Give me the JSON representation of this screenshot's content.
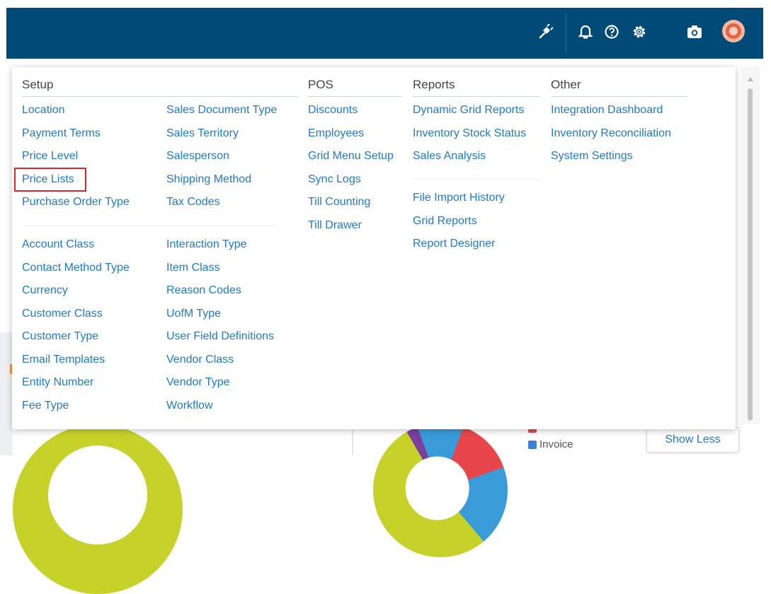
{
  "menu": {
    "setup": {
      "header": "Setup",
      "col1a": [
        "Location",
        "Payment Terms",
        "Price Level",
        "Price Lists",
        "Purchase Order Type"
      ],
      "col2a": [
        "Sales Document Type",
        "Sales Territory",
        "Salesperson",
        "Shipping Method",
        "Tax Codes"
      ],
      "col1b": [
        "Account Class",
        "Contact Method Type",
        "Currency",
        "Customer Class",
        "Customer Type",
        "Email Templates",
        "Entity Number",
        "Fee Type"
      ],
      "col2b": [
        "Interaction Type",
        "Item Class",
        "Reason Codes",
        "UofM Type",
        "User Field Definitions",
        "Vendor Class",
        "Vendor Type",
        "Workflow"
      ]
    },
    "pos": {
      "header": "POS",
      "items": [
        "Discounts",
        "Employees",
        "Grid Menu Setup",
        "Sync Logs",
        "Till Counting",
        "Till Drawer"
      ]
    },
    "reports": {
      "header": "Reports",
      "items_a": [
        "Dynamic Grid Reports",
        "Inventory Stock Status",
        "Sales Analysis"
      ],
      "items_b": [
        "File Import History",
        "Grid Reports",
        "Report Designer"
      ]
    },
    "other": {
      "header": "Other",
      "items": [
        "Integration Dashboard",
        "Inventory Reconciliation",
        "System Settings"
      ]
    },
    "highlighted_item": "Price Lists"
  },
  "background": {
    "legend_invoice": "Invoice",
    "show_less": "Show Less"
  },
  "colors": {
    "topbar": "#004a77",
    "link": "#1f79c8",
    "highlight_border": "#e0242b"
  },
  "icons": [
    "plug-icon",
    "bell-icon",
    "help-icon",
    "gear-icon",
    "camera-icon",
    "avatar"
  ]
}
